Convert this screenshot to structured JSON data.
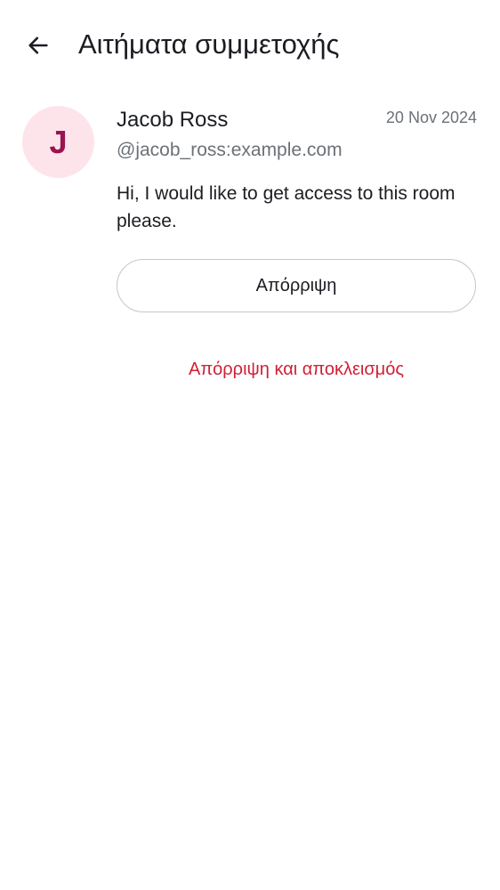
{
  "header": {
    "back_icon": "arrow-left-icon",
    "title": "Αιτήματα συμμετοχής"
  },
  "request": {
    "avatar_initial": "J",
    "avatar_bg_color": "#fde4eb",
    "avatar_text_color": "#9a1350",
    "display_name": "Jacob Ross",
    "user_id": "@jacob_ross:example.com",
    "date": "20 Nov 2024",
    "message": "Hi, I would like to get access to this room please.",
    "decline_label": "Απόρριψη",
    "decline_and_ban_label": "Απόρριψη και αποκλεισμός",
    "danger_color": "#d01f34"
  }
}
